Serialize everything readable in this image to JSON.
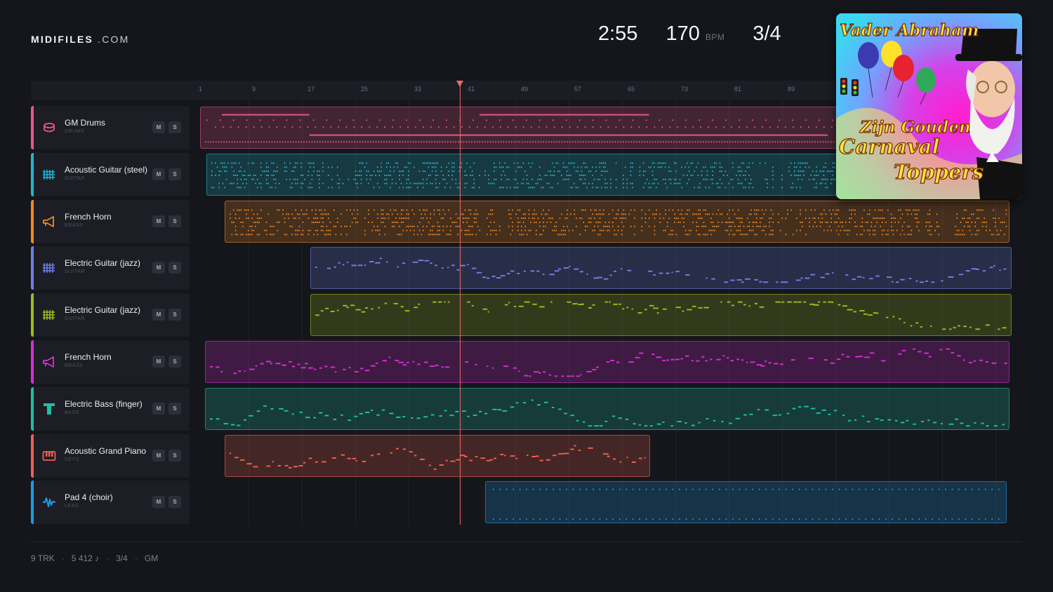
{
  "brand": {
    "name": "MIDIFILES",
    "suffix": ".COM"
  },
  "stats": {
    "time": "2:55",
    "bpm": "170",
    "bpm_unit": "BPM",
    "meter": "3/4"
  },
  "ruler": {
    "ticks": [
      "1",
      "9",
      "17",
      "25",
      "33",
      "41",
      "49",
      "57",
      "65",
      "73",
      "81",
      "89"
    ]
  },
  "album": {
    "artist": "Vader Abraham",
    "title_line1": "Zijn Gouden",
    "title_line2": "Carnaval",
    "title_line3": "Toppers"
  },
  "tracks": [
    {
      "name": "GM Drums",
      "category": "DRUMS",
      "color": "#e8578a",
      "icon": "drum-icon",
      "mute": "M",
      "solo": "S"
    },
    {
      "name": "Acoustic Guitar (steel)",
      "category": "GUITAR",
      "color": "#22b4cf",
      "icon": "guitar-fretboard-icon",
      "mute": "M",
      "solo": "S"
    },
    {
      "name": "French Horn",
      "category": "BRASS",
      "color": "#f08a24",
      "icon": "horn-icon",
      "mute": "M",
      "solo": "S"
    },
    {
      "name": "Electric Guitar (jazz)",
      "category": "GUITAR",
      "color": "#6f7fe6",
      "icon": "guitar-fretboard-icon",
      "mute": "M",
      "solo": "S"
    },
    {
      "name": "Electric Guitar (jazz)",
      "category": "GUITAR",
      "color": "#9fbb1f",
      "icon": "guitar-fretboard-icon",
      "mute": "M",
      "solo": "S"
    },
    {
      "name": "French Horn",
      "category": "BRASS",
      "color": "#d62fd6",
      "icon": "horn-icon",
      "mute": "M",
      "solo": "S"
    },
    {
      "name": "Electric Bass (finger)",
      "category": "BASS",
      "color": "#1fbfa6",
      "icon": "bass-icon",
      "mute": "M",
      "solo": "S"
    },
    {
      "name": "Acoustic Grand Piano",
      "category": "KEYS",
      "color": "#f0604f",
      "icon": "piano-icon",
      "mute": "M",
      "solo": "S"
    },
    {
      "name": "Pad 4 (choir)",
      "category": "LEAD",
      "color": "#1e9be6",
      "icon": "waveform-icon",
      "mute": "M",
      "solo": "S"
    }
  ],
  "footer": {
    "tracks": "9 TRK",
    "notes": "5 412 ♪",
    "meter": "3/4",
    "standard": "GM"
  }
}
